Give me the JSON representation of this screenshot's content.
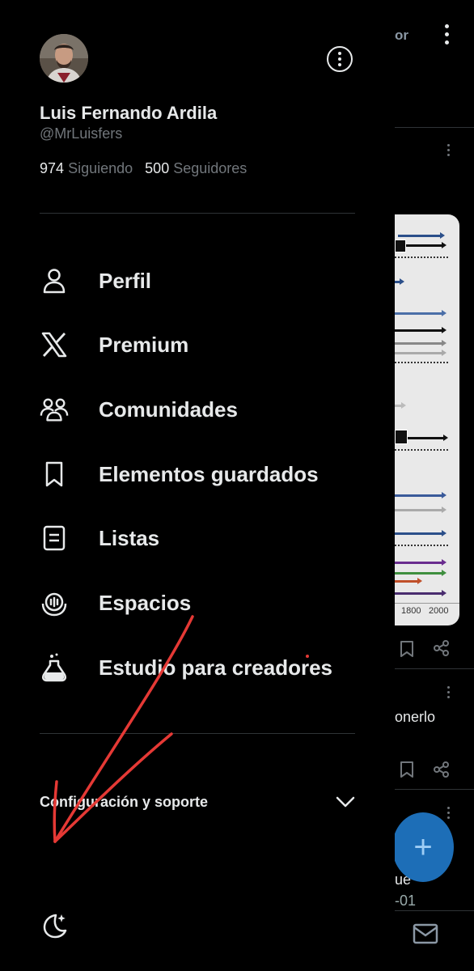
{
  "profile": {
    "name": "Luis Fernando Ardila",
    "handle": "@MrLuisfers",
    "following_count": "974",
    "following_label": "Siguiendo",
    "followers_count": "500",
    "followers_label": "Seguidores"
  },
  "menu": [
    {
      "label": "Perfil",
      "icon": "person-icon"
    },
    {
      "label": "Premium",
      "icon": "x-logo-icon"
    },
    {
      "label": "Comunidades",
      "icon": "communities-icon"
    },
    {
      "label": "Elementos guardados",
      "icon": "bookmark-icon"
    },
    {
      "label": "Listas",
      "icon": "list-icon"
    },
    {
      "label": "Espacios",
      "icon": "spaces-icon"
    },
    {
      "label": "Estudio para creadores",
      "icon": "flask-icon"
    }
  ],
  "settings": {
    "label": "Configuración y soporte",
    "icon": "chevron-down-icon"
  },
  "feed": {
    "header_partial": "or",
    "chart_ticks": [
      "1800",
      "2000"
    ],
    "text_partial_1": "onerlo",
    "text_partial_2": "ue",
    "text_partial_3": "-01"
  },
  "fab": {
    "icon": "compose-plus-icon",
    "glyph": "+"
  },
  "colors": {
    "background": "#000000",
    "text_primary": "#e7e9ea",
    "text_secondary": "#71767b",
    "divider": "#2f3336",
    "accent": "#1d6eb7",
    "annotation": "#e53935"
  }
}
